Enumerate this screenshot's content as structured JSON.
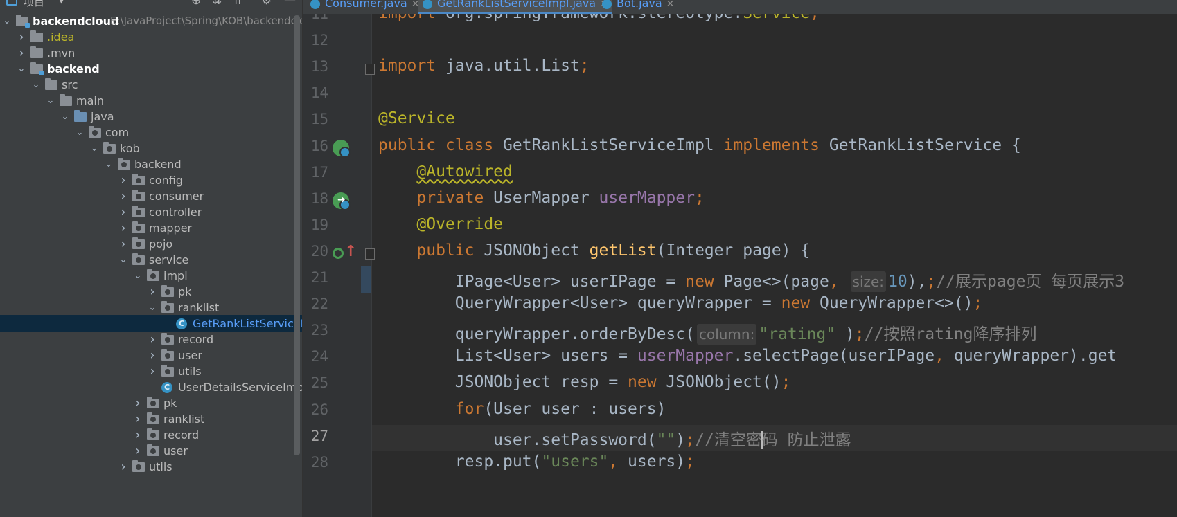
{
  "sidebar": {
    "header_label": "项目",
    "tree": [
      {
        "label": "backendcloud",
        "path": "E:\\JavaProject\\Spring\\KOB\\backendcloud",
        "depth": 0,
        "expanded": true,
        "kind": "module",
        "style": "bold"
      },
      {
        "label": ".idea",
        "depth": 1,
        "expanded": false,
        "kind": "folder",
        "style": "yellow"
      },
      {
        "label": ".mvn",
        "depth": 1,
        "expanded": false,
        "kind": "folder",
        "style": ""
      },
      {
        "label": "backend",
        "depth": 1,
        "expanded": true,
        "kind": "module",
        "style": "bold"
      },
      {
        "label": "src",
        "depth": 2,
        "expanded": true,
        "kind": "folder",
        "style": ""
      },
      {
        "label": "main",
        "depth": 3,
        "expanded": true,
        "kind": "folder",
        "style": ""
      },
      {
        "label": "java",
        "depth": 4,
        "expanded": true,
        "kind": "source",
        "style": ""
      },
      {
        "label": "com",
        "depth": 5,
        "expanded": true,
        "kind": "package",
        "style": ""
      },
      {
        "label": "kob",
        "depth": 6,
        "expanded": true,
        "kind": "package",
        "style": ""
      },
      {
        "label": "backend",
        "depth": 7,
        "expanded": true,
        "kind": "package",
        "style": ""
      },
      {
        "label": "config",
        "depth": 8,
        "expanded": false,
        "kind": "package",
        "style": ""
      },
      {
        "label": "consumer",
        "depth": 8,
        "expanded": false,
        "kind": "package",
        "style": ""
      },
      {
        "label": "controller",
        "depth": 8,
        "expanded": false,
        "kind": "package",
        "style": ""
      },
      {
        "label": "mapper",
        "depth": 8,
        "expanded": false,
        "kind": "package",
        "style": ""
      },
      {
        "label": "pojo",
        "depth": 8,
        "expanded": false,
        "kind": "package",
        "style": ""
      },
      {
        "label": "service",
        "depth": 8,
        "expanded": true,
        "kind": "package",
        "style": ""
      },
      {
        "label": "impl",
        "depth": 9,
        "expanded": true,
        "kind": "package",
        "style": ""
      },
      {
        "label": "pk",
        "depth": 10,
        "expanded": false,
        "kind": "package",
        "style": ""
      },
      {
        "label": "ranklist",
        "depth": 10,
        "expanded": true,
        "kind": "package",
        "style": ""
      },
      {
        "label": "GetRankListServiceImpl",
        "depth": 11,
        "expanded": null,
        "kind": "class",
        "style": "blue",
        "selected": true
      },
      {
        "label": "record",
        "depth": 10,
        "expanded": false,
        "kind": "package",
        "style": ""
      },
      {
        "label": "user",
        "depth": 10,
        "expanded": false,
        "kind": "package",
        "style": ""
      },
      {
        "label": "utils",
        "depth": 10,
        "expanded": false,
        "kind": "package",
        "style": ""
      },
      {
        "label": "UserDetailsServiceImpl",
        "depth": 10,
        "expanded": null,
        "kind": "class",
        "style": ""
      },
      {
        "label": "pk",
        "depth": 9,
        "expanded": false,
        "kind": "package",
        "style": ""
      },
      {
        "label": "ranklist",
        "depth": 9,
        "expanded": false,
        "kind": "package",
        "style": ""
      },
      {
        "label": "record",
        "depth": 9,
        "expanded": false,
        "kind": "package",
        "style": ""
      },
      {
        "label": "user",
        "depth": 9,
        "expanded": false,
        "kind": "package",
        "style": ""
      },
      {
        "label": "utils",
        "depth": 8,
        "expanded": false,
        "kind": "package",
        "style": ""
      }
    ]
  },
  "tabs": [
    {
      "label": "Consumer.java",
      "active": false
    },
    {
      "label": "GetRankListServiceImpl.java",
      "active": true
    },
    {
      "label": "Bot.java",
      "active": false
    }
  ],
  "editor": {
    "current_line": 27,
    "lines": [
      {
        "n": 11,
        "segments": [
          [
            "kw",
            "import "
          ],
          [
            "",
            "org.springframework.stereotype."
          ],
          [
            "ann",
            "Service"
          ],
          [
            "kw",
            ";"
          ]
        ]
      },
      {
        "n": 12,
        "segments": []
      },
      {
        "n": 13,
        "segments": [
          [
            "kw",
            "import "
          ],
          [
            "",
            "java.util.List"
          ],
          [
            "kw",
            ";"
          ]
        ]
      },
      {
        "n": 14,
        "segments": []
      },
      {
        "n": 15,
        "segments": [
          [
            "ann",
            "@Service"
          ]
        ]
      },
      {
        "n": 16,
        "segments": [
          [
            "kw",
            "public class "
          ],
          [
            "",
            "GetRankListServiceImpl "
          ],
          [
            "kw",
            "implements "
          ],
          [
            "",
            "GetRankListService {"
          ]
        ]
      },
      {
        "n": 17,
        "segments": [
          [
            "",
            "    "
          ],
          [
            "ann sq",
            "@Autowired"
          ]
        ]
      },
      {
        "n": 18,
        "segments": [
          [
            "",
            "    "
          ],
          [
            "kw",
            "private "
          ],
          [
            "",
            "UserMapper "
          ],
          [
            "fld",
            "userMapper"
          ],
          [
            "kw",
            ";"
          ]
        ]
      },
      {
        "n": 19,
        "segments": [
          [
            "",
            "    "
          ],
          [
            "ann",
            "@Override"
          ]
        ]
      },
      {
        "n": 20,
        "segments": [
          [
            "",
            "    "
          ],
          [
            "kw",
            "public "
          ],
          [
            "",
            "JSONObject "
          ],
          [
            "fn",
            "getList"
          ],
          [
            "",
            "(Integer page) {"
          ]
        ]
      },
      {
        "n": 21,
        "segments": [
          [
            "",
            "        IPage<User> userIPage = "
          ],
          [
            "kw",
            "new "
          ],
          [
            "",
            "Page<>(page"
          ],
          [
            "kw",
            ", "
          ],
          [
            "hint",
            "size:"
          ],
          [
            "num",
            "10"
          ],
          [
            "",
            "),"
          ],
          [
            "kw",
            ";"
          ],
          [
            "cmt",
            "//展示page页 每页展示3"
          ]
        ]
      },
      {
        "n": 22,
        "segments": [
          [
            "",
            "        QueryWrapper<User> queryWrapper = "
          ],
          [
            "kw",
            "new "
          ],
          [
            "",
            "QueryWrapper<>()"
          ],
          [
            "kw",
            ";"
          ]
        ]
      },
      {
        "n": 23,
        "segments": [
          [
            "",
            "        queryWrapper.orderByDesc("
          ],
          [
            "hint",
            "column:"
          ],
          [
            "str",
            "\"rating\""
          ],
          [
            "",
            " )"
          ],
          [
            "kw",
            ";"
          ],
          [
            "cmt",
            "//按照rating降序排列"
          ]
        ]
      },
      {
        "n": 24,
        "segments": [
          [
            "",
            "        List<User> users = "
          ],
          [
            "fld",
            "userMapper"
          ],
          [
            "",
            ".selectPage(userIPage"
          ],
          [
            "kw",
            ", "
          ],
          [
            "",
            "queryWrapper).get"
          ]
        ]
      },
      {
        "n": 25,
        "segments": [
          [
            "",
            "        JSONObject resp = "
          ],
          [
            "kw",
            "new "
          ],
          [
            "",
            "JSONObject()"
          ],
          [
            "kw",
            ";"
          ]
        ]
      },
      {
        "n": 26,
        "segments": [
          [
            "",
            "        "
          ],
          [
            "kw",
            "for"
          ],
          [
            "",
            "(User user : users)"
          ]
        ]
      },
      {
        "n": 27,
        "segments": [
          [
            "",
            "            user.setPassword("
          ],
          [
            "str",
            "\"\""
          ],
          [
            "",
            ")"
          ],
          [
            "kw",
            ";"
          ],
          [
            "cmt",
            "//清空密"
          ],
          [
            "caret",
            ""
          ],
          [
            "cmt",
            "码 防止泄露"
          ]
        ]
      },
      {
        "n": 28,
        "segments": [
          [
            "",
            "        resp.put("
          ],
          [
            "str",
            "\"users\""
          ],
          [
            "kw",
            ", "
          ],
          [
            "",
            "users)"
          ],
          [
            "kw",
            ";"
          ]
        ]
      }
    ]
  }
}
